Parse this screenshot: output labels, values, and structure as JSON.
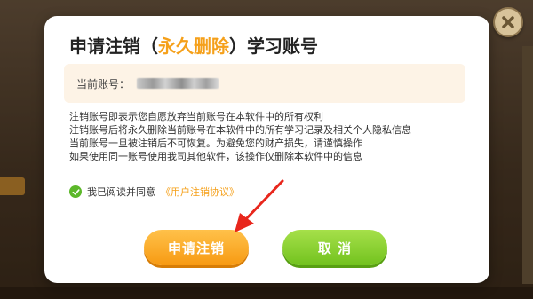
{
  "dialog": {
    "title_prefix": "申请注销（",
    "title_highlight": "永久删除",
    "title_suffix": "）学习账号",
    "account_label": "当前账号：",
    "notice_lines": [
      "注销账号即表示您自愿放弃当前账号在本软件中的所有权利",
      "注销账号后将永久删除当前账号在本软件中的所有学习记录及相关个人隐私信息",
      "当前账号一旦被注销后不可恢复。为避免您的财产损失，请谨慎操作",
      "如果使用同一账号使用我司其他软件，该操作仅删除本软件中的信息"
    ],
    "agree_text": "我已阅读并同意",
    "agree_link": "《用户注销协议》",
    "agree_checked": true,
    "confirm_label": "申请注销",
    "cancel_label": "取 消"
  },
  "colors": {
    "accent_orange": "#f5a01a",
    "accent_green": "#72c21e"
  },
  "icons": {
    "close": "close-icon",
    "check": "checkmark-icon",
    "annotation": "red-arrow-icon"
  }
}
